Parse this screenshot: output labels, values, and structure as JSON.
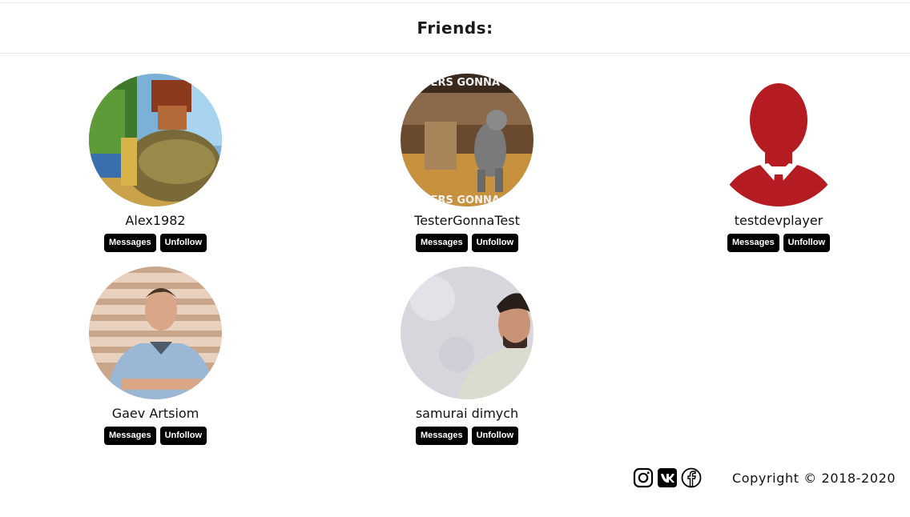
{
  "header": {
    "title": "Friends:"
  },
  "friends": [
    {
      "name": "Alex1982",
      "messages_label": "Messages",
      "unfollow_label": "Unfollow",
      "avatar": "game-character-avatar"
    },
    {
      "name": "TesterGonnaTest",
      "messages_label": "Messages",
      "unfollow_label": "Unfollow",
      "avatar": "dancing-cat-meme-avatar",
      "avatar_text": "TESTERS GONNA TEST"
    },
    {
      "name": "testdevplayer",
      "messages_label": "Messages",
      "unfollow_label": "Unfollow",
      "avatar": "default-silhouette-avatar"
    },
    {
      "name": "Gaev Artsiom",
      "messages_label": "Messages",
      "unfollow_label": "Unfollow",
      "avatar": "man-photo-avatar"
    },
    {
      "name": "samurai dimych",
      "messages_label": "Messages",
      "unfollow_label": "Unfollow",
      "avatar": "man-photo-avatar"
    }
  ],
  "footer": {
    "icons": [
      "instagram-icon",
      "vk-icon",
      "facebook-icon"
    ],
    "copyright": "Copyright © 2018-2020"
  },
  "colors": {
    "button_bg": "#000000",
    "button_text": "#ffffff",
    "silhouette": "#b51c22"
  }
}
